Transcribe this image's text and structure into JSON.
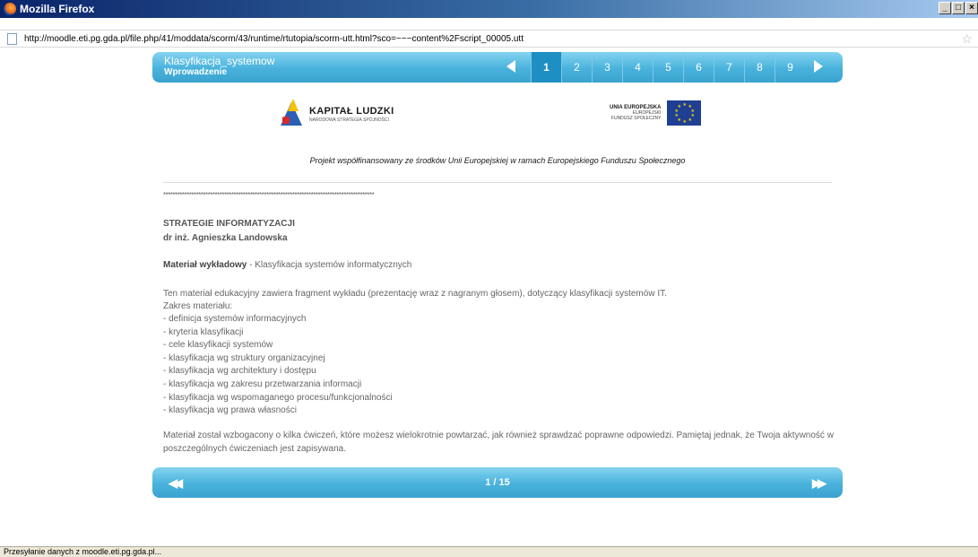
{
  "window": {
    "title": "Mozilla Firefox",
    "buttons": [
      "_",
      "□",
      "×"
    ]
  },
  "addressbar": {
    "url": "http://moodle.eti.pg.gda.pl/file.php/41/moddata/scorm/43/runtime/rtutopia/scorm-utt.html?sco=~~~content%2Fscript_00005.utt"
  },
  "toolbar": {
    "course_title": "Klasyfikacja_systemow",
    "section_title": "Wprowadzenie",
    "pages": [
      "1",
      "2",
      "3",
      "4",
      "5",
      "6",
      "7",
      "8",
      "9"
    ],
    "active_page": "1"
  },
  "logos": {
    "left_name": "KAPITAŁ LUDZKI",
    "left_sub": "NARODOWA STRATEGIA SPÓJNOŚCI",
    "right_name": "UNIA EUROPEJSKA",
    "right_sub1": "EUROPEJSKI",
    "right_sub2": "FUNDUSZ SPOŁECZNY"
  },
  "content": {
    "cofinance": "Projekt współfinansowany ze środków Unii Europejskiej w ramach Europejskiego Funduszu Społecznego",
    "stars": "******************************************************************************************",
    "heading": "STRATEGIE INFORMATYZACJI",
    "author": "dr inż. Agnieszka Landowska",
    "material_label": "Materiał wykładowy",
    "material_desc": " - Klasyfikacja systemów informatycznych",
    "intro": "Ten materiał edukacyjny zawiera fragment wykładu (prezentację wraz z nagranym głosem), dotyczący klasyfikacji systemów IT.",
    "scope_label": "Zakres materiału:",
    "scope_items": [
      "- definicja systemów informacyjnych",
      "- kryteria klasyfikacji",
      "- cele klasyfikacji systemów",
      "- klasyfikacja wg struktury organizacyjnej",
      "- klasyfikacja wg architektury i dostępu",
      "- klasyfikacja wg zakresu przetwarzania informacji",
      "- klasyfikacja wg wspomaganego procesu/funkcjonalności",
      "- klasyfikacja wg prawa własności"
    ],
    "outro": "Materiał został wzbogacony o kilka ćwiczeń, które możesz wielokrotnie powtarzać, jak również sprawdzać poprawne odpowiedzi. Pamiętaj jednak, że Twoja aktywność w poszczególnych ćwiczeniach jest zapisywana."
  },
  "footer": {
    "counter": "1 / 15",
    "first_symbol": "◀◀",
    "last_symbol": "▶▶"
  },
  "statusbar": {
    "text": "Przesyłanie danych z moodle.eti.pg.gda.pl..."
  },
  "colors": {
    "toolbar_light": "#84d3f0",
    "toolbar_dark": "#3aa2cf",
    "active_page": "#1e8fc3",
    "titlebar": "#0a246a"
  }
}
